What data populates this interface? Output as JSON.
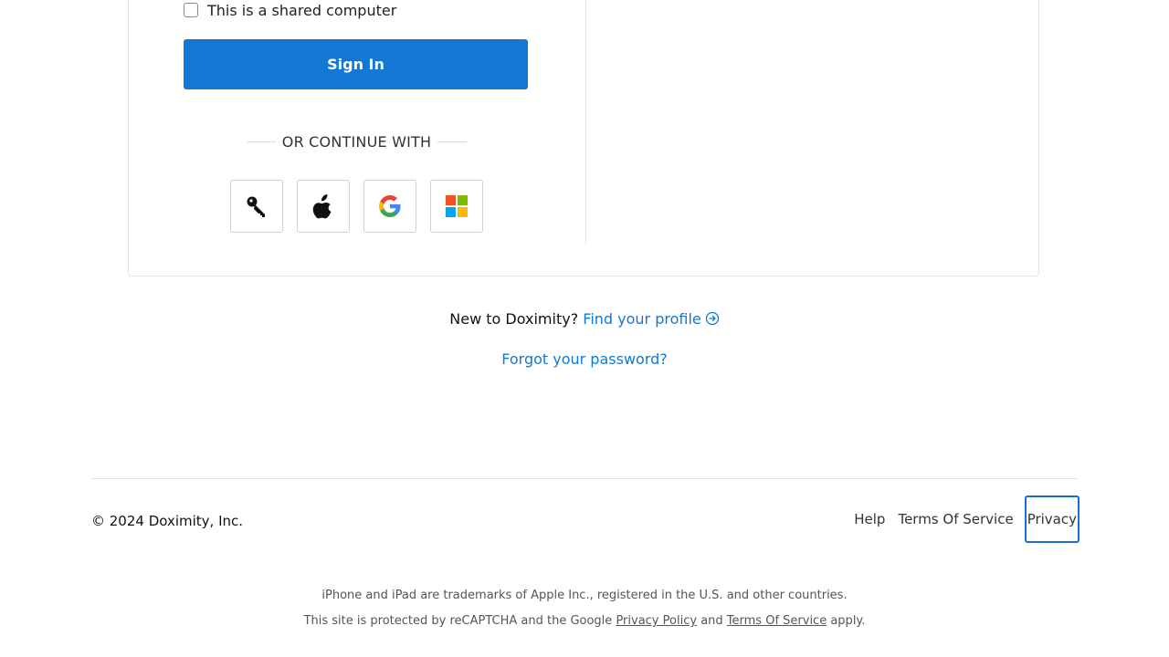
{
  "login": {
    "shared_computer_label": "This is a shared computer",
    "sign_in_label": "Sign In",
    "or_continue_label": "OR CONTINUE WITH",
    "sso_providers": [
      "passkey-icon",
      "apple-icon",
      "google-icon",
      "microsoft-icon"
    ]
  },
  "signup": {
    "prompt": "New to Doximity?",
    "find_profile_label": "Find your profile",
    "forgot_password_label": "Forgot your password?"
  },
  "footer": {
    "copyright": "© 2024 Doximity, Inc.",
    "links": {
      "help": "Help",
      "terms": "Terms Of Service",
      "privacy": "Privacy"
    },
    "trademark_notice": "iPhone and iPad are trademarks of Apple Inc., registered in the U.S. and other countries.",
    "recaptcha_prefix": "This site is protected by reCAPTCHA and the Google",
    "recaptcha_privacy": "Privacy Policy",
    "recaptcha_and": "and",
    "recaptcha_terms": "Terms Of Service",
    "recaptcha_suffix": "apply."
  },
  "colors": {
    "primary": "#1477d3",
    "border": "#e3e3e3",
    "focus_ring": "#1a6fd0"
  }
}
